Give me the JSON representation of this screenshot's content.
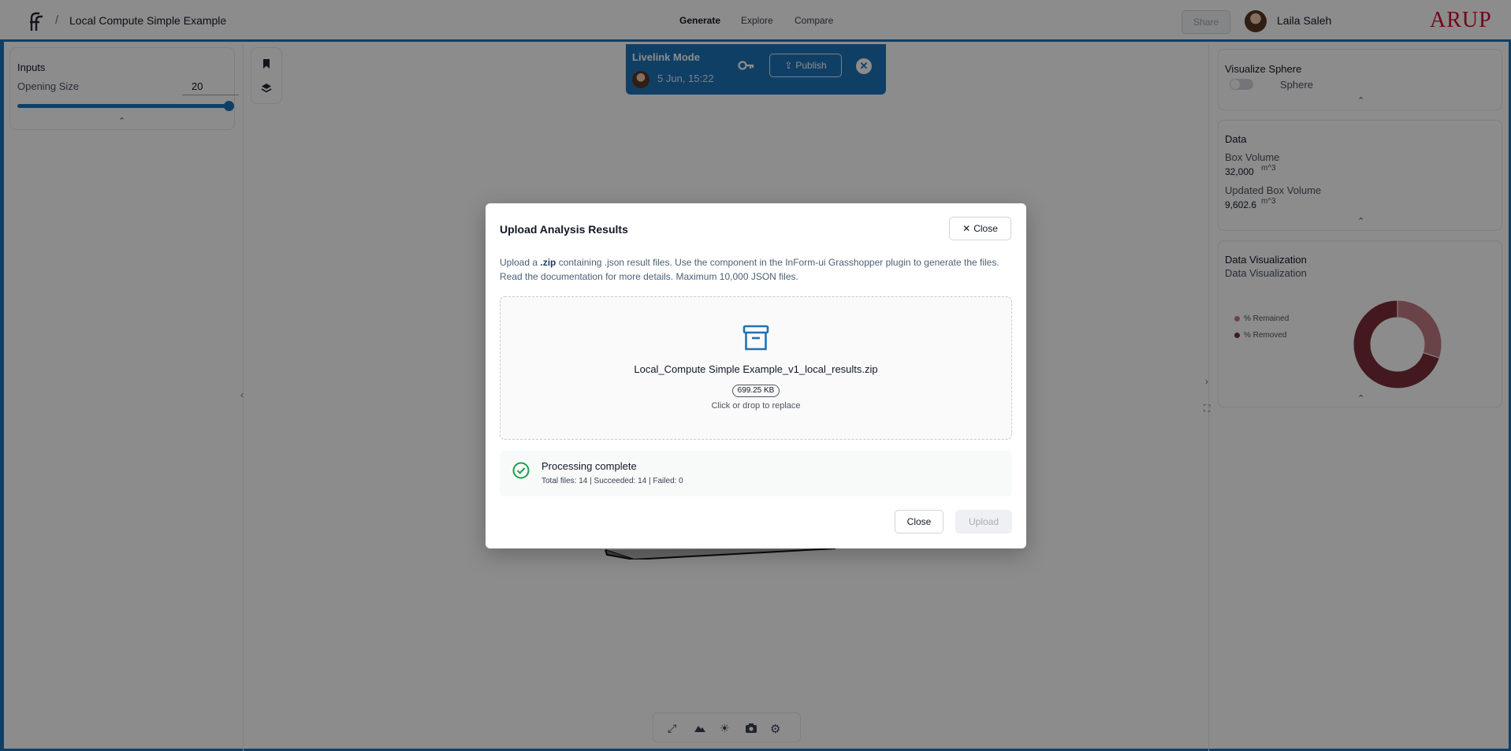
{
  "header": {
    "breadcrumb_separator": "/",
    "project_title": "Local Compute Simple Example",
    "nav": [
      "Generate",
      "Explore",
      "Compare"
    ],
    "active_nav": "Generate",
    "share_label": "Share",
    "user_name": "Laila Saleh",
    "brand": "ARUP"
  },
  "inputs_panel": {
    "title": "Inputs",
    "opening_size_label": "Opening Size",
    "opening_size_value": "20",
    "slider_fraction": 1.0
  },
  "livelink": {
    "title": "Livelink Mode",
    "date": "5 Jun, 15:22",
    "publish_label": "Publish"
  },
  "right_panel": {
    "visualize": {
      "title": "Visualize Sphere",
      "toggle_label": "Sphere",
      "toggle_on": false
    },
    "data": {
      "title": "Data",
      "box_volume_label": "Box Volume",
      "box_volume_value": "32,000",
      "box_volume_unit": "m^3",
      "updated_volume_label": "Updated Box Volume",
      "updated_volume_value": "9,602.6",
      "updated_volume_unit": "m^3"
    },
    "data_viz": {
      "title": "Data Visualization",
      "subtitle": "Data Visualization"
    }
  },
  "chart_data": {
    "type": "pie",
    "categories": [
      "% Remained",
      "% Removed"
    ],
    "values": [
      30,
      70
    ],
    "colors": [
      "#c27b85",
      "#7a2e3a"
    ],
    "legend": "left",
    "title": ""
  },
  "dialog": {
    "title": "Upload Analysis Results",
    "close_top_label": "Close",
    "desc_prefix": "Upload a ",
    "desc_bold": ".zip",
    "desc_suffix": " containing .json result files. Use the component in the InForm-ui Grasshopper plugin to generate the files. Read the documentation for more details. Maximum 10,000 JSON files.",
    "file_name": "Local_Compute Simple Example_v1_local_results.zip",
    "file_size": "699.25 KB",
    "replace_hint": "Click or drop to replace",
    "status_title": "Processing complete",
    "status_detail": "Total files: 14 | Succeeded: 14 | Failed: 0",
    "close_bottom_label": "Close",
    "upload_label": "Upload"
  },
  "colors": {
    "accent": "#1e73b8",
    "brand": "#c8102e",
    "success": "#16a34a"
  }
}
